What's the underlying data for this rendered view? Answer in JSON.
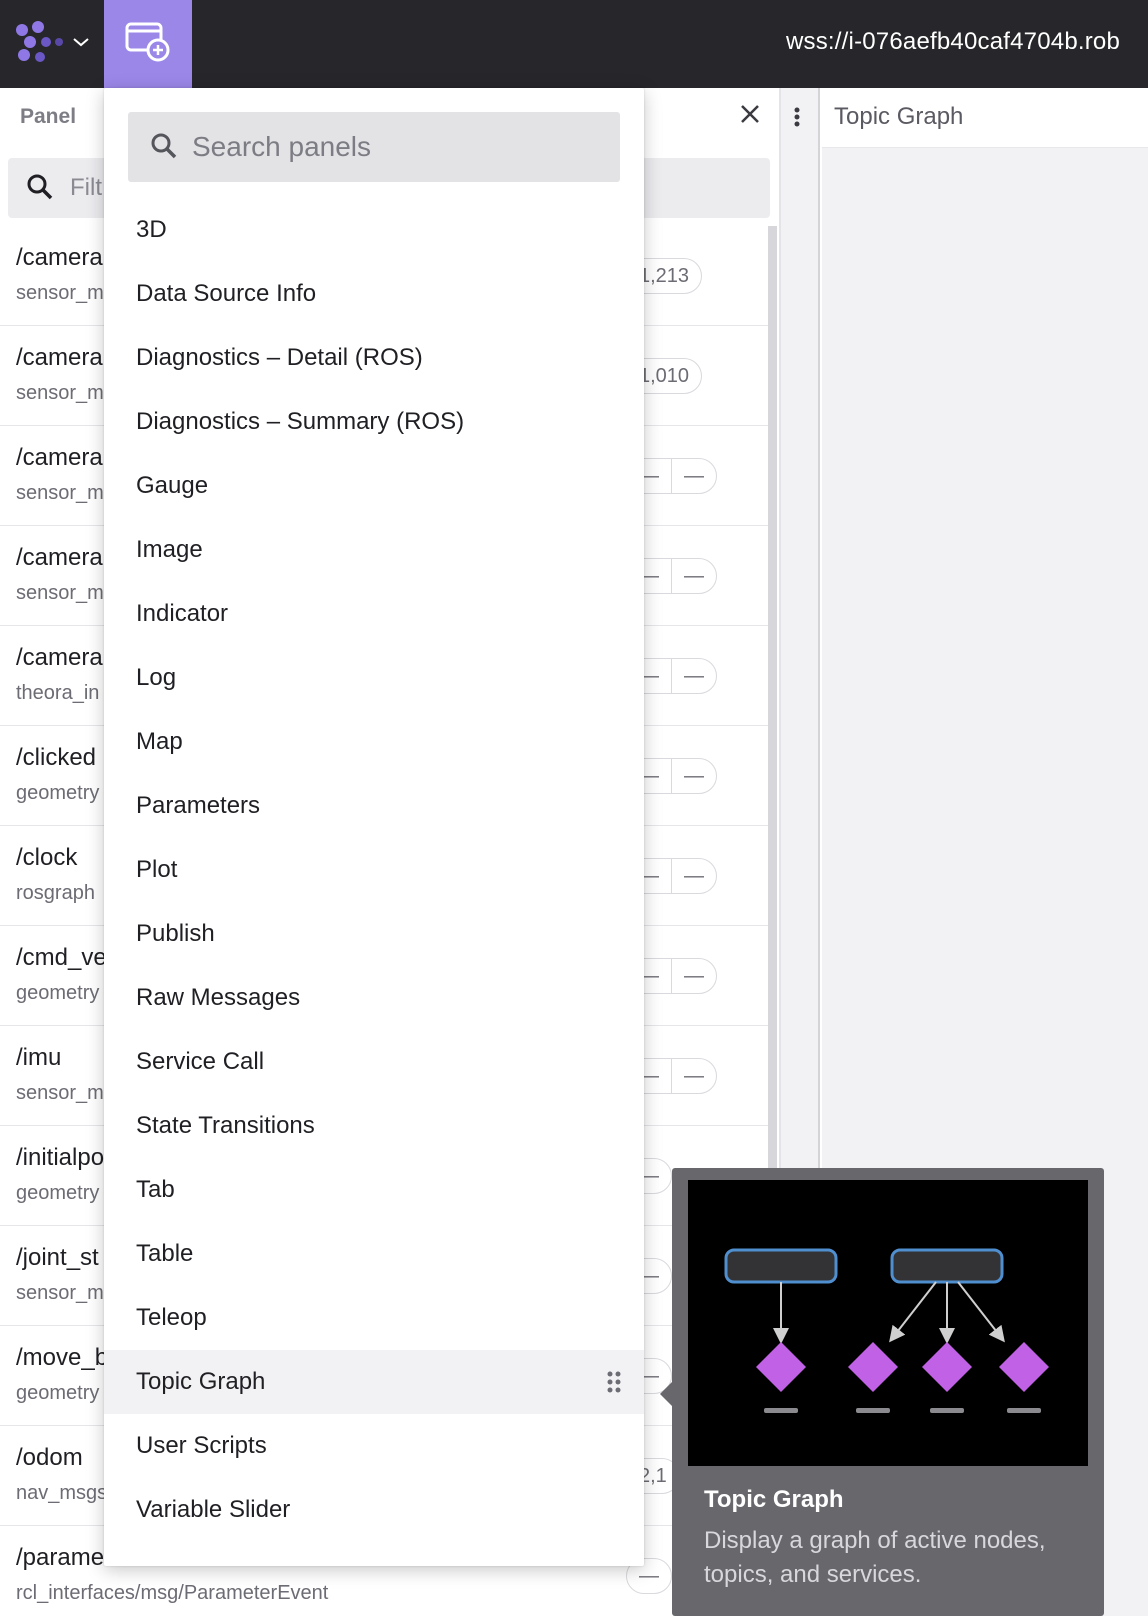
{
  "topbar": {
    "connection_url": "wss://i-076aefb40caf4704b.rob",
    "logo_icon": "app-logo-icon",
    "add_panel_icon": "add-panel-icon",
    "accent_color": "#9b87e8"
  },
  "sidebar": {
    "title": "Panel",
    "filter_placeholder": "Filt",
    "topics": [
      {
        "name": "/camera",
        "type": "sensor_m",
        "stat": [
          "1,213"
        ]
      },
      {
        "name": "/camera",
        "type": "sensor_m",
        "stat": [
          "1,010"
        ]
      },
      {
        "name": "/camera",
        "type": "sensor_m",
        "stat": [
          "—",
          "—"
        ]
      },
      {
        "name": "/camera",
        "type": "sensor_m",
        "stat": [
          "—",
          "—"
        ]
      },
      {
        "name": "/camera",
        "type": "theora_in",
        "stat": [
          "—",
          "—"
        ]
      },
      {
        "name": "/clicked",
        "type": "geometry",
        "stat": [
          "—",
          "—"
        ]
      },
      {
        "name": "/clock",
        "type": "rosgraph",
        "stat": [
          "—",
          "—"
        ]
      },
      {
        "name": "/cmd_ve",
        "type": "geometry",
        "stat": [
          "—",
          "—"
        ]
      },
      {
        "name": "/imu",
        "type": "sensor_m",
        "stat": [
          "—",
          "—"
        ]
      },
      {
        "name": "/initialpo",
        "type": "geometry",
        "stat": [
          "—"
        ]
      },
      {
        "name": "/joint_st",
        "type": "sensor_m",
        "stat": [
          "—"
        ]
      },
      {
        "name": "/move_b",
        "type": "geometry",
        "stat": [
          "—"
        ]
      },
      {
        "name": "/odom",
        "type": "nav_msgs",
        "stat": [
          "2,1"
        ]
      },
      {
        "name": "/parame",
        "type": "rcl_interfaces/msg/ParameterEvent",
        "stat": [
          "—"
        ]
      }
    ]
  },
  "right_panel": {
    "title": "Topic Graph"
  },
  "dropdown": {
    "search_placeholder": "Search panels",
    "items": [
      "3D",
      "Data Source Info",
      "Diagnostics – Detail (ROS)",
      "Diagnostics – Summary (ROS)",
      "Gauge",
      "Image",
      "Indicator",
      "Log",
      "Map",
      "Parameters",
      "Plot",
      "Publish",
      "Raw Messages",
      "Service Call",
      "State Transitions",
      "Tab",
      "Table",
      "Teleop",
      "Topic Graph",
      "User Scripts",
      "Variable Slider"
    ],
    "hovered_item": "Topic Graph"
  },
  "tooltip": {
    "title": "Topic Graph",
    "description": "Display a graph of active nodes, topics, and services.",
    "node_color": "#c061e6",
    "box_border_color": "#4f8fd0"
  }
}
